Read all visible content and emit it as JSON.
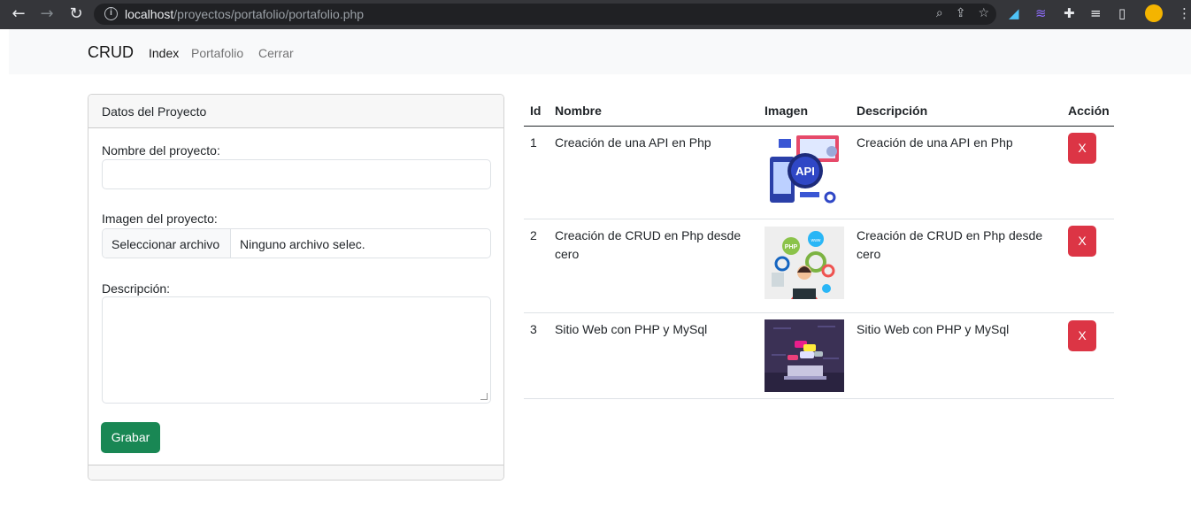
{
  "browser": {
    "url_host": "localhost",
    "url_path": "/proyectos/portafolio/portafolio.php"
  },
  "navbar": {
    "brand": "CRUD",
    "links": [
      "Index",
      "Portafolio",
      "Cerrar"
    ]
  },
  "form": {
    "header": "Datos del Proyecto",
    "name_label": "Nombre del proyecto:",
    "name_value": "",
    "image_label": "Imagen del proyecto:",
    "file_button": "Seleccionar archivo",
    "file_status": "Ninguno archivo selec.",
    "description_label": "Descripción:",
    "description_value": "",
    "save_button": "Grabar"
  },
  "table": {
    "headers": [
      "Id",
      "Nombre",
      "Imagen",
      "Descripción",
      "Acción"
    ],
    "rows": [
      {
        "id": "1",
        "nombre": "Creación de una API en Php",
        "imagen": "api-illustration",
        "descripcion": "Creación de una API en Php",
        "accion": "X"
      },
      {
        "id": "2",
        "nombre": "Creación de CRUD en Php desde cero",
        "imagen": "php-developer-illustration",
        "descripcion": "Creación de CRUD en Php desde cero",
        "accion": "X"
      },
      {
        "id": "3",
        "nombre": "Sitio Web con PHP y MySql",
        "imagen": "laptop-code-illustration",
        "descripcion": "Sitio Web con PHP y MySql",
        "accion": "X"
      }
    ]
  },
  "colors": {
    "save_button": "#198754",
    "delete_button": "#dc3545",
    "navbar_bg": "#f8f9fa",
    "chrome_bg": "#35363a"
  }
}
